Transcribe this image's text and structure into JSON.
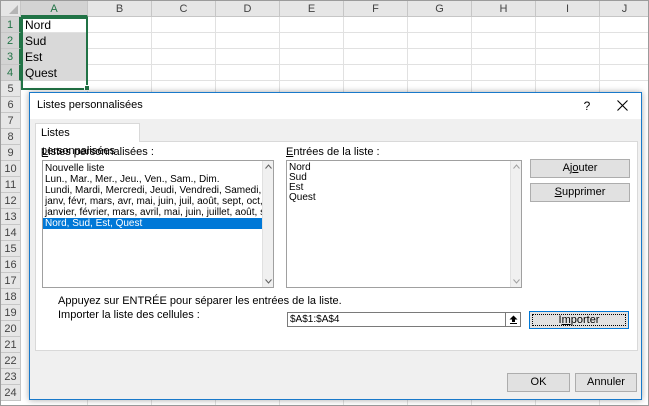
{
  "sheet": {
    "columns": [
      "A",
      "B",
      "C",
      "D",
      "E",
      "F",
      "G",
      "H",
      "I",
      "J"
    ],
    "rows": [
      "1",
      "2",
      "3",
      "4",
      "5",
      "6",
      "7",
      "8",
      "9",
      "10",
      "11",
      "12",
      "13",
      "14",
      "15",
      "16",
      "17",
      "18",
      "19",
      "20",
      "21",
      "22",
      "23",
      "24"
    ],
    "cells": [
      "Nord",
      "Sud",
      "Est",
      "Quest"
    ],
    "colors": {
      "selection": "#217346",
      "header_bg": "#e6e6e6"
    }
  },
  "dialog": {
    "title": "Listes personnalisées",
    "help_label": "?",
    "tab_label": "Listes personnalisées",
    "lists_label_access": "L",
    "lists_label_rest": "istes personnalisées :",
    "lists": [
      "Nouvelle liste",
      "Lun., Mar., Mer., Jeu., Ven., Sam., Dim.",
      "Lundi, Mardi, Mercredi, Jeudi, Vendredi, Samedi, Dim",
      "janv, févr, mars, avr, mai, juin, juil, août, sept, oct, no",
      "janvier, février, mars, avril, mai, juin, juillet, août, sep",
      "Nord, Sud, Est, Quest"
    ],
    "selected_list_index": 5,
    "entries_label_access": "E",
    "entries_label_rest": "ntrées de la liste :",
    "entries": [
      "Nord",
      "Sud",
      "Est",
      "Quest"
    ],
    "add_button_pre": "Aj",
    "add_button_access": "o",
    "add_button_post": "uter",
    "delete_button_access": "S",
    "delete_button_rest": "upprimer",
    "hint": "Appuyez sur ENTRÉE pour séparer les entrées de la liste.",
    "import_label": "Importer la liste des cellules :",
    "import_range": "$A$1:$A$4",
    "import_button_pre": "I",
    "import_button_access": "m",
    "import_button_post": "porter",
    "ok_label": "OK",
    "cancel_label": "Annuler",
    "colors": {
      "accent": "#0078d7",
      "border": "#1979ca",
      "client_bg": "#f0f0f0"
    }
  }
}
